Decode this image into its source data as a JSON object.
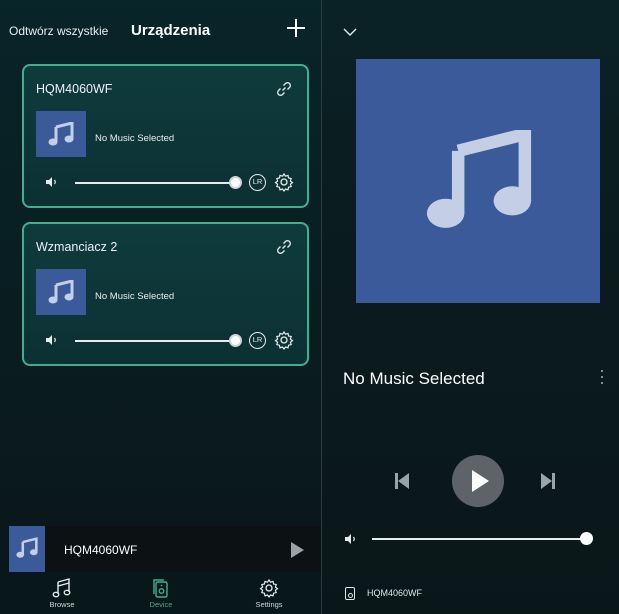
{
  "header": {
    "play_all": "Odtwórz wszystkie",
    "title": "Urządzenia",
    "add_icon": "plus-icon"
  },
  "devices": [
    {
      "name": "HQM4060WF",
      "track": "No Music Selected",
      "volume": 1.0,
      "channel": "LR"
    },
    {
      "name": "Wzmanciacz 2",
      "track": "No Music Selected",
      "volume": 1.0,
      "channel": "LR"
    }
  ],
  "mini_player": {
    "device": "HQM4060WF"
  },
  "nav": {
    "items": [
      {
        "label": "Browse",
        "icon": "music-note-icon"
      },
      {
        "label": "Device",
        "icon": "device-icon",
        "active": true
      },
      {
        "label": "Settings",
        "icon": "gear-icon"
      }
    ]
  },
  "now_playing": {
    "title": "No Music Selected",
    "volume": 1.0,
    "device": "HQM4060WF"
  },
  "colors": {
    "accent": "#3fb08f",
    "art_blue": "#3b5a9a",
    "background": "#0a1a1e"
  }
}
